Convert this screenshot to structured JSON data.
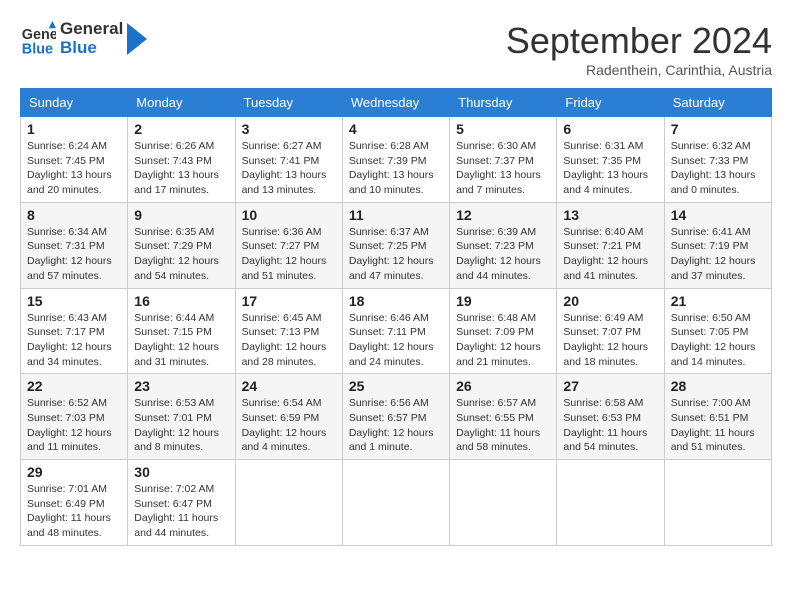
{
  "logo": {
    "line1": "General",
    "line2": "Blue"
  },
  "title": "September 2024",
  "subtitle": "Radenthein, Carinthia, Austria",
  "weekdays": [
    "Sunday",
    "Monday",
    "Tuesday",
    "Wednesday",
    "Thursday",
    "Friday",
    "Saturday"
  ],
  "weeks": [
    [
      {
        "day": "1",
        "sunrise": "6:24 AM",
        "sunset": "7:45 PM",
        "daylight": "13 hours and 20 minutes."
      },
      {
        "day": "2",
        "sunrise": "6:26 AM",
        "sunset": "7:43 PM",
        "daylight": "13 hours and 17 minutes."
      },
      {
        "day": "3",
        "sunrise": "6:27 AM",
        "sunset": "7:41 PM",
        "daylight": "13 hours and 13 minutes."
      },
      {
        "day": "4",
        "sunrise": "6:28 AM",
        "sunset": "7:39 PM",
        "daylight": "13 hours and 10 minutes."
      },
      {
        "day": "5",
        "sunrise": "6:30 AM",
        "sunset": "7:37 PM",
        "daylight": "13 hours and 7 minutes."
      },
      {
        "day": "6",
        "sunrise": "6:31 AM",
        "sunset": "7:35 PM",
        "daylight": "13 hours and 4 minutes."
      },
      {
        "day": "7",
        "sunrise": "6:32 AM",
        "sunset": "7:33 PM",
        "daylight": "13 hours and 0 minutes."
      }
    ],
    [
      {
        "day": "8",
        "sunrise": "6:34 AM",
        "sunset": "7:31 PM",
        "daylight": "12 hours and 57 minutes."
      },
      {
        "day": "9",
        "sunrise": "6:35 AM",
        "sunset": "7:29 PM",
        "daylight": "12 hours and 54 minutes."
      },
      {
        "day": "10",
        "sunrise": "6:36 AM",
        "sunset": "7:27 PM",
        "daylight": "12 hours and 51 minutes."
      },
      {
        "day": "11",
        "sunrise": "6:37 AM",
        "sunset": "7:25 PM",
        "daylight": "12 hours and 47 minutes."
      },
      {
        "day": "12",
        "sunrise": "6:39 AM",
        "sunset": "7:23 PM",
        "daylight": "12 hours and 44 minutes."
      },
      {
        "day": "13",
        "sunrise": "6:40 AM",
        "sunset": "7:21 PM",
        "daylight": "12 hours and 41 minutes."
      },
      {
        "day": "14",
        "sunrise": "6:41 AM",
        "sunset": "7:19 PM",
        "daylight": "12 hours and 37 minutes."
      }
    ],
    [
      {
        "day": "15",
        "sunrise": "6:43 AM",
        "sunset": "7:17 PM",
        "daylight": "12 hours and 34 minutes."
      },
      {
        "day": "16",
        "sunrise": "6:44 AM",
        "sunset": "7:15 PM",
        "daylight": "12 hours and 31 minutes."
      },
      {
        "day": "17",
        "sunrise": "6:45 AM",
        "sunset": "7:13 PM",
        "daylight": "12 hours and 28 minutes."
      },
      {
        "day": "18",
        "sunrise": "6:46 AM",
        "sunset": "7:11 PM",
        "daylight": "12 hours and 24 minutes."
      },
      {
        "day": "19",
        "sunrise": "6:48 AM",
        "sunset": "7:09 PM",
        "daylight": "12 hours and 21 minutes."
      },
      {
        "day": "20",
        "sunrise": "6:49 AM",
        "sunset": "7:07 PM",
        "daylight": "12 hours and 18 minutes."
      },
      {
        "day": "21",
        "sunrise": "6:50 AM",
        "sunset": "7:05 PM",
        "daylight": "12 hours and 14 minutes."
      }
    ],
    [
      {
        "day": "22",
        "sunrise": "6:52 AM",
        "sunset": "7:03 PM",
        "daylight": "12 hours and 11 minutes."
      },
      {
        "day": "23",
        "sunrise": "6:53 AM",
        "sunset": "7:01 PM",
        "daylight": "12 hours and 8 minutes."
      },
      {
        "day": "24",
        "sunrise": "6:54 AM",
        "sunset": "6:59 PM",
        "daylight": "12 hours and 4 minutes."
      },
      {
        "day": "25",
        "sunrise": "6:56 AM",
        "sunset": "6:57 PM",
        "daylight": "12 hours and 1 minute."
      },
      {
        "day": "26",
        "sunrise": "6:57 AM",
        "sunset": "6:55 PM",
        "daylight": "11 hours and 58 minutes."
      },
      {
        "day": "27",
        "sunrise": "6:58 AM",
        "sunset": "6:53 PM",
        "daylight": "11 hours and 54 minutes."
      },
      {
        "day": "28",
        "sunrise": "7:00 AM",
        "sunset": "6:51 PM",
        "daylight": "11 hours and 51 minutes."
      }
    ],
    [
      {
        "day": "29",
        "sunrise": "7:01 AM",
        "sunset": "6:49 PM",
        "daylight": "11 hours and 48 minutes."
      },
      {
        "day": "30",
        "sunrise": "7:02 AM",
        "sunset": "6:47 PM",
        "daylight": "11 hours and 44 minutes."
      },
      null,
      null,
      null,
      null,
      null
    ]
  ],
  "labels": {
    "sunrise": "Sunrise: ",
    "sunset": "Sunset: ",
    "daylight": "Daylight: "
  }
}
